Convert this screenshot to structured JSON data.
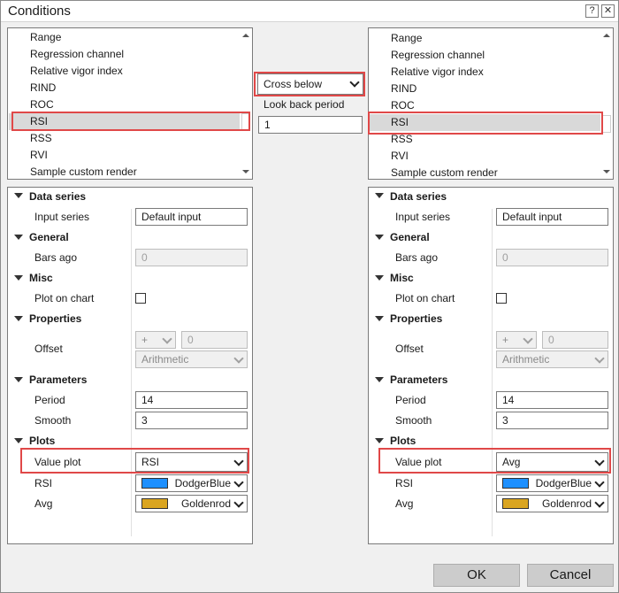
{
  "window": {
    "title": "Conditions",
    "help_glyph": "?",
    "close_glyph": "✕"
  },
  "left_list": {
    "items": [
      "Range",
      "Regression channel",
      "Relative vigor index",
      "RIND",
      "ROC",
      "RSI",
      "RSS",
      "RVI",
      "Sample custom render"
    ],
    "selected": "RSI"
  },
  "right_list": {
    "items": [
      "Range",
      "Regression channel",
      "Relative vigor index",
      "RIND",
      "ROC",
      "RSI",
      "RSS",
      "RVI",
      "Sample custom render"
    ],
    "selected": "RSI"
  },
  "middle": {
    "condition_value": "Cross below",
    "lookback_label": "Look back period",
    "lookback_value": "1"
  },
  "left_props": {
    "data_series": "Data series",
    "input_series_label": "Input series",
    "input_series_value": "Default input",
    "general": "General",
    "bars_ago_label": "Bars ago",
    "bars_ago_value": "0",
    "misc": "Misc",
    "plot_on_chart_label": "Plot on chart",
    "properties": "Properties",
    "offset_label": "Offset",
    "offset_op": "+",
    "offset_value": "0",
    "offset_type": "Arithmetic",
    "parameters": "Parameters",
    "period_label": "Period",
    "period_value": "14",
    "smooth_label": "Smooth",
    "smooth_value": "3",
    "plots": "Plots",
    "value_plot_label": "Value plot",
    "value_plot_value": "RSI",
    "rsi_label": "RSI",
    "rsi_color_name": "DodgerBlue",
    "rsi_color": "#1e90ff",
    "avg_label": "Avg",
    "avg_color_name": "Goldenrod",
    "avg_color": "#daa520"
  },
  "right_props": {
    "data_series": "Data series",
    "input_series_label": "Input series",
    "input_series_value": "Default input",
    "general": "General",
    "bars_ago_label": "Bars ago",
    "bars_ago_value": "0",
    "misc": "Misc",
    "plot_on_chart_label": "Plot on chart",
    "properties": "Properties",
    "offset_label": "Offset",
    "offset_op": "+",
    "offset_value": "0",
    "offset_type": "Arithmetic",
    "parameters": "Parameters",
    "period_label": "Period",
    "period_value": "14",
    "smooth_label": "Smooth",
    "smooth_value": "3",
    "plots": "Plots",
    "value_plot_label": "Value plot",
    "value_plot_value": "Avg",
    "rsi_label": "RSI",
    "rsi_color_name": "DodgerBlue",
    "rsi_color": "#1e90ff",
    "avg_label": "Avg",
    "avg_color_name": "Goldenrod",
    "avg_color": "#daa520"
  },
  "buttons": {
    "ok": "OK",
    "cancel": "Cancel"
  },
  "colors": {
    "highlight": "#e04848",
    "selected_row": "#d9d9d9",
    "button_bg": "#cccccc"
  }
}
